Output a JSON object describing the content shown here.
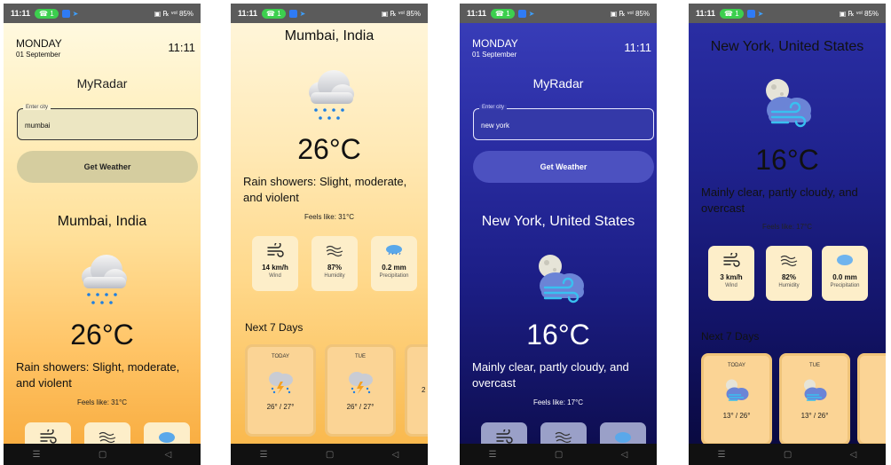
{
  "status": {
    "time": "11:11",
    "call_badge": "1",
    "right_icons": "▣ ℞ ᵛᵒˡ 85%"
  },
  "nav": {
    "menu": "☰",
    "home": "▢",
    "back": "◁"
  },
  "app": {
    "title": "MyRadar",
    "field_label": "Enter city",
    "button": "Get Weather",
    "feels_prefix": "Feels like: ",
    "next_title": "Next 7 Days"
  },
  "mumbai": {
    "day": "MONDAY",
    "date": "01 September",
    "clock": "11:11",
    "input": "mumbai",
    "city": "Mumbai, India",
    "temp": "26°C",
    "desc": "Rain showers: Slight, moderate, and violent",
    "feels": "Feels like: 31°C",
    "metrics": [
      {
        "value": "14 km/h",
        "label": "Wind",
        "icon": "wind-icon"
      },
      {
        "value": "87%",
        "label": "Humidity",
        "icon": "humidity-icon"
      },
      {
        "value": "0.2 mm",
        "label": "Precipitation",
        "icon": "precipitation-icon"
      }
    ],
    "days": [
      {
        "name": "TODAY",
        "range": "26° / 27°"
      },
      {
        "name": "TUE",
        "range": "26° / 27°"
      },
      {
        "name": "",
        "range": "2"
      }
    ]
  },
  "newyork": {
    "day": "MONDAY",
    "date": "01 September",
    "clock": "11:11",
    "input": "new york",
    "city": "New York, United States",
    "temp": "16°C",
    "desc": "Mainly clear, partly cloudy, and overcast",
    "feels": "Feels like: 17°C",
    "metrics": [
      {
        "value": "3 km/h",
        "label": "Wind",
        "icon": "wind-icon"
      },
      {
        "value": "82%",
        "label": "Humidity",
        "icon": "humidity-icon"
      },
      {
        "value": "0.0 mm",
        "label": "Precipitation",
        "icon": "precipitation-icon"
      }
    ],
    "days": [
      {
        "name": "TODAY",
        "range": "13° / 26°"
      },
      {
        "name": "TUE",
        "range": "13° / 26°"
      }
    ]
  },
  "colors": {
    "warm_top": "#fffbe6",
    "warm_bottom": "#f7a93a",
    "dark_top": "#3a3fbb",
    "dark_bottom": "#0c0c4a"
  }
}
